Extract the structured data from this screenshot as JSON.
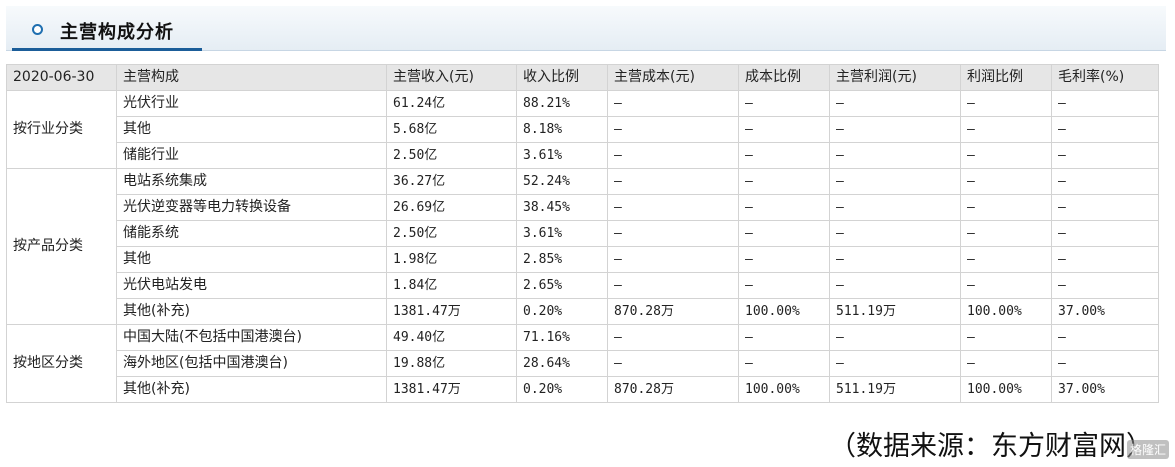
{
  "panel": {
    "title": "主营构成分析"
  },
  "table": {
    "headers": [
      "2020-06-30",
      "主营构成",
      "主营收入(元)",
      "收入比例",
      "主营成本(元)",
      "成本比例",
      "主营利润(元)",
      "利润比例",
      "毛利率(%)"
    ],
    "groups": [
      {
        "label": "按行业分类",
        "rows": [
          [
            "光伏行业",
            "61.24亿",
            "88.21%",
            "—",
            "—",
            "—",
            "—",
            "—"
          ],
          [
            "其他",
            "5.68亿",
            "8.18%",
            "—",
            "—",
            "—",
            "—",
            "—"
          ],
          [
            "储能行业",
            "2.50亿",
            "3.61%",
            "—",
            "—",
            "—",
            "—",
            "—"
          ]
        ]
      },
      {
        "label": "按产品分类",
        "rows": [
          [
            "电站系统集成",
            "36.27亿",
            "52.24%",
            "—",
            "—",
            "—",
            "—",
            "—"
          ],
          [
            "光伏逆变器等电力转换设备",
            "26.69亿",
            "38.45%",
            "—",
            "—",
            "—",
            "—",
            "—"
          ],
          [
            "储能系统",
            "2.50亿",
            "3.61%",
            "—",
            "—",
            "—",
            "—",
            "—"
          ],
          [
            "其他",
            "1.98亿",
            "2.85%",
            "—",
            "—",
            "—",
            "—",
            "—"
          ],
          [
            "光伏电站发电",
            "1.84亿",
            "2.65%",
            "—",
            "—",
            "—",
            "—",
            "—"
          ],
          [
            "其他(补充)",
            "1381.47万",
            "0.20%",
            "870.28万",
            "100.00%",
            "511.19万",
            "100.00%",
            "37.00%"
          ]
        ]
      },
      {
        "label": "按地区分类",
        "rows": [
          [
            "中国大陆(不包括中国港澳台)",
            "49.40亿",
            "71.16%",
            "—",
            "—",
            "—",
            "—",
            "—"
          ],
          [
            "海外地区(包括中国港澳台)",
            "19.88亿",
            "28.64%",
            "—",
            "—",
            "—",
            "—",
            "—"
          ],
          [
            "其他(补充)",
            "1381.47万",
            "0.20%",
            "870.28万",
            "100.00%",
            "511.19万",
            "100.00%",
            "37.00%"
          ]
        ]
      }
    ]
  },
  "source_note": "（数据来源：东方财富网）",
  "watermark": "格隆汇"
}
